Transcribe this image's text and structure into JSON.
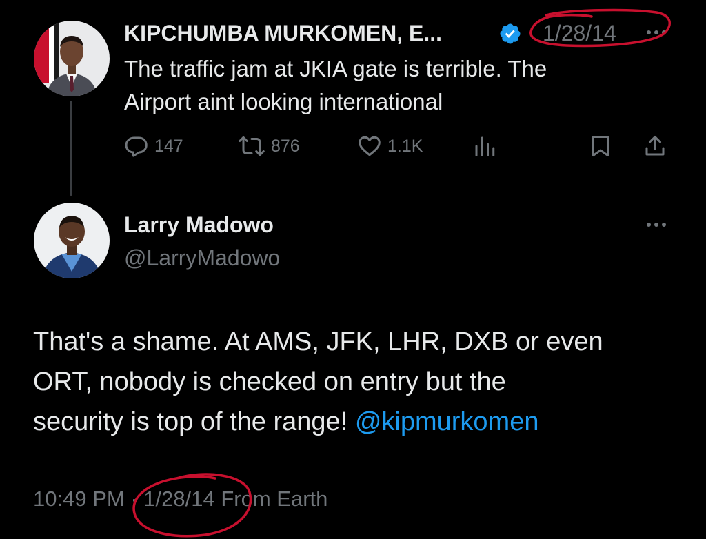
{
  "original_tweet": {
    "author_name": "KIPCHUMBA MURKOMEN, E...",
    "date": "1/28/14",
    "text_line1": "The traffic jam at JKIA gate is terrible. The",
    "text_line2": "Airport aint looking international",
    "replies": "147",
    "retweets": "876",
    "likes": "1.1K",
    "icons": [
      "verified-badge-icon",
      "reply-icon",
      "retweet-icon",
      "like-icon",
      "analytics-icon",
      "bookmark-icon",
      "share-icon",
      "more-icon"
    ]
  },
  "reply_tweet": {
    "author_name": "Larry Madowo",
    "handle": "@LarryMadowo",
    "text_line1": "That's a shame. At AMS, JFK, LHR, DXB or even",
    "text_line2": "ORT, nobody is checked on entry but the",
    "text_line3_prefix": "security is top of the range! ",
    "mention": "@kipmurkomen",
    "time": "10:49 PM",
    "separator": "·",
    "date": "1/28/14",
    "source": "From Earth"
  },
  "colors": {
    "background": "#000000",
    "text": "#e7e9ea",
    "muted": "#71767b",
    "link": "#1d9bf0",
    "verified": "#1d9bf0",
    "annotation": "#c8102e"
  }
}
